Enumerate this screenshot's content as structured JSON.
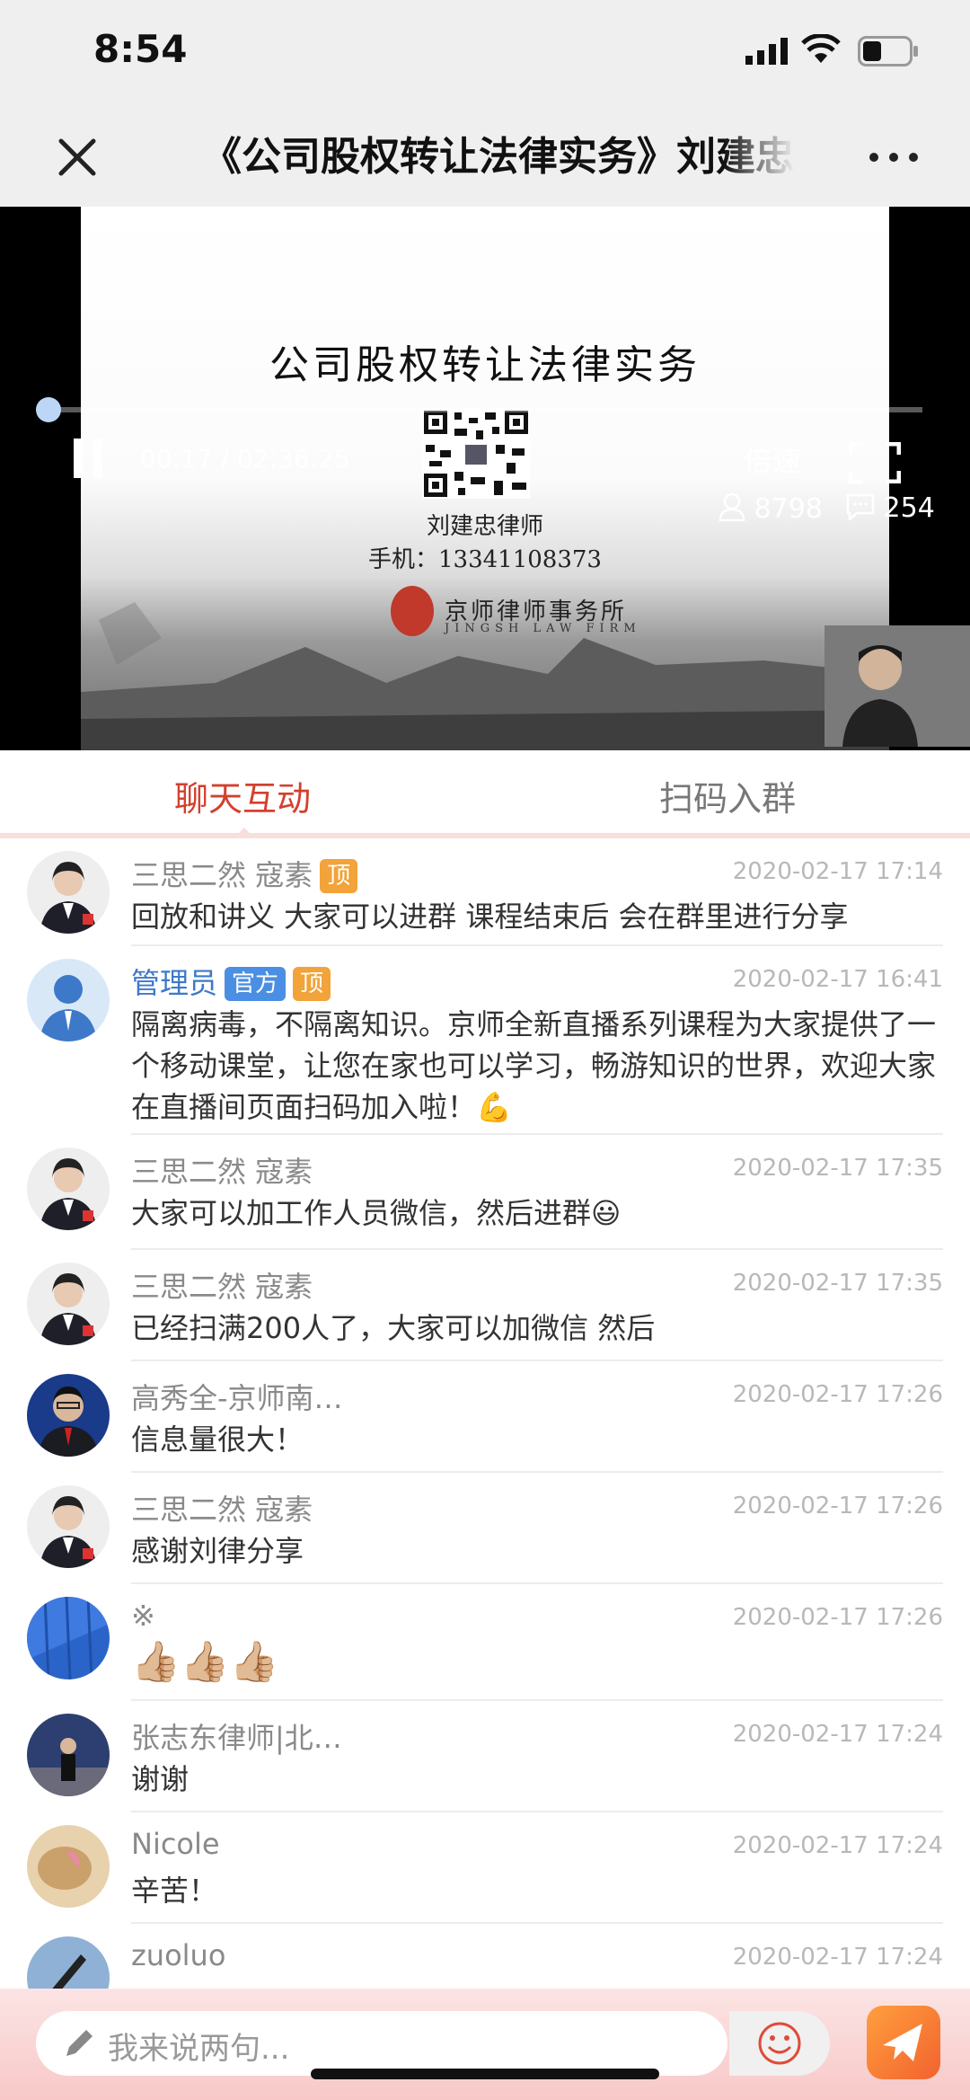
{
  "status_bar": {
    "time": "8:54"
  },
  "nav": {
    "title": "《公司股权转让法律实务》刘建忠律师"
  },
  "slide": {
    "title": "公司股权转让法律实务",
    "presenter": "刘建忠律师",
    "phone": "手机：13341108373",
    "seal_text": "京师",
    "firm_cn": "京师律师事务所",
    "firm_en": "JINGSH LAW FIRM"
  },
  "player": {
    "elapsed": "00:17",
    "duration": "02:36:25",
    "time_display": "00:17 / 02:36:25",
    "progress_fraction": 0.0018,
    "speed_label": "倍速",
    "viewers": "8798",
    "comments": "254"
  },
  "tabs": [
    {
      "label": "聊天互动",
      "active": true
    },
    {
      "label": "扫码入群",
      "active": false
    }
  ],
  "messages": [
    {
      "name": "三思二然 寇素",
      "badges": [
        "顶"
      ],
      "time": "2020-02-17 17:14",
      "text": "回放和讲义 大家可以进群 课程结束后 会在群里进行分享",
      "avatar": "person-female-icon"
    },
    {
      "name": "管理员",
      "badges": [
        "官方",
        "顶"
      ],
      "time": "2020-02-17 16:41",
      "text": "隔离病毒，不隔离知识。京师全新直播系列课程为大家提供了一个移动课堂，让您在家也可以学习，畅游知识的世界，欢迎大家在直播间页面扫码加入啦！💪",
      "avatar": "admin-icon"
    },
    {
      "name": "三思二然 寇素",
      "badges": [],
      "time": "2020-02-17 17:35",
      "text": "大家可以加工作人员微信，然后进群😃",
      "avatar": "person-female-icon"
    },
    {
      "name": "三思二然 寇素",
      "badges": [],
      "time": "2020-02-17 17:35",
      "text": "已经扫满200人了，大家可以加微信 然后",
      "avatar": "person-female-icon"
    },
    {
      "name": "高秀全-京师南…",
      "badges": [],
      "time": "2020-02-17 17:26",
      "text": "信息量很大！",
      "avatar": "person-male-icon"
    },
    {
      "name": "三思二然 寇素",
      "badges": [],
      "time": "2020-02-17 17:26",
      "text": "感谢刘律分享",
      "avatar": "person-female-icon"
    },
    {
      "name": "※",
      "badges": [],
      "time": "2020-02-17 17:26",
      "text": "👍🏼👍🏼👍🏼",
      "avatar": "blue-building-icon"
    },
    {
      "name": "张志东律师|北…",
      "badges": [],
      "time": "2020-02-17 17:24",
      "text": "谢谢",
      "avatar": "stage-person-icon"
    },
    {
      "name": "Nicole",
      "badges": [],
      "time": "2020-02-17 17:24",
      "text": "辛苦！",
      "avatar": "food-photo-icon"
    },
    {
      "name": "zuoluo",
      "badges": [],
      "time": "2020-02-17 17:24",
      "text": "",
      "avatar": "sky-photo-icon"
    }
  ],
  "input": {
    "placeholder": "我来说两句..."
  },
  "colors": {
    "accent": "#d3402e",
    "badge_top": "#f2a33a",
    "badge_official": "#4a8fe3",
    "progress": "#6aa8f0"
  }
}
